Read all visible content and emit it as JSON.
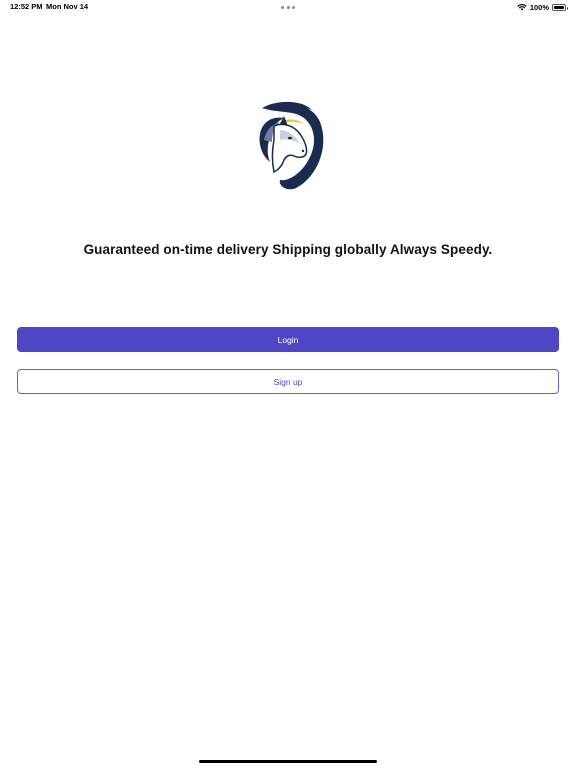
{
  "status_bar": {
    "time": "12:52 PM",
    "date": "Mon Nov 14",
    "battery_percent_label": "100%",
    "battery_level": 1.0,
    "icons": [
      "wifi-icon",
      "battery-icon",
      "multitasking-dots-icon"
    ]
  },
  "logo": {
    "icon": "horse-head-logo-icon",
    "colors": {
      "primary": "#1b2a4e",
      "accent": "#c8d32a"
    }
  },
  "welcome": {
    "tagline": "Guaranteed on-time delivery Shipping globally Always Speedy."
  },
  "actions": {
    "login_label": "Login",
    "signup_label": "Sign up"
  },
  "theme": {
    "accent": "#4f46c4",
    "background": "#ffffff"
  }
}
